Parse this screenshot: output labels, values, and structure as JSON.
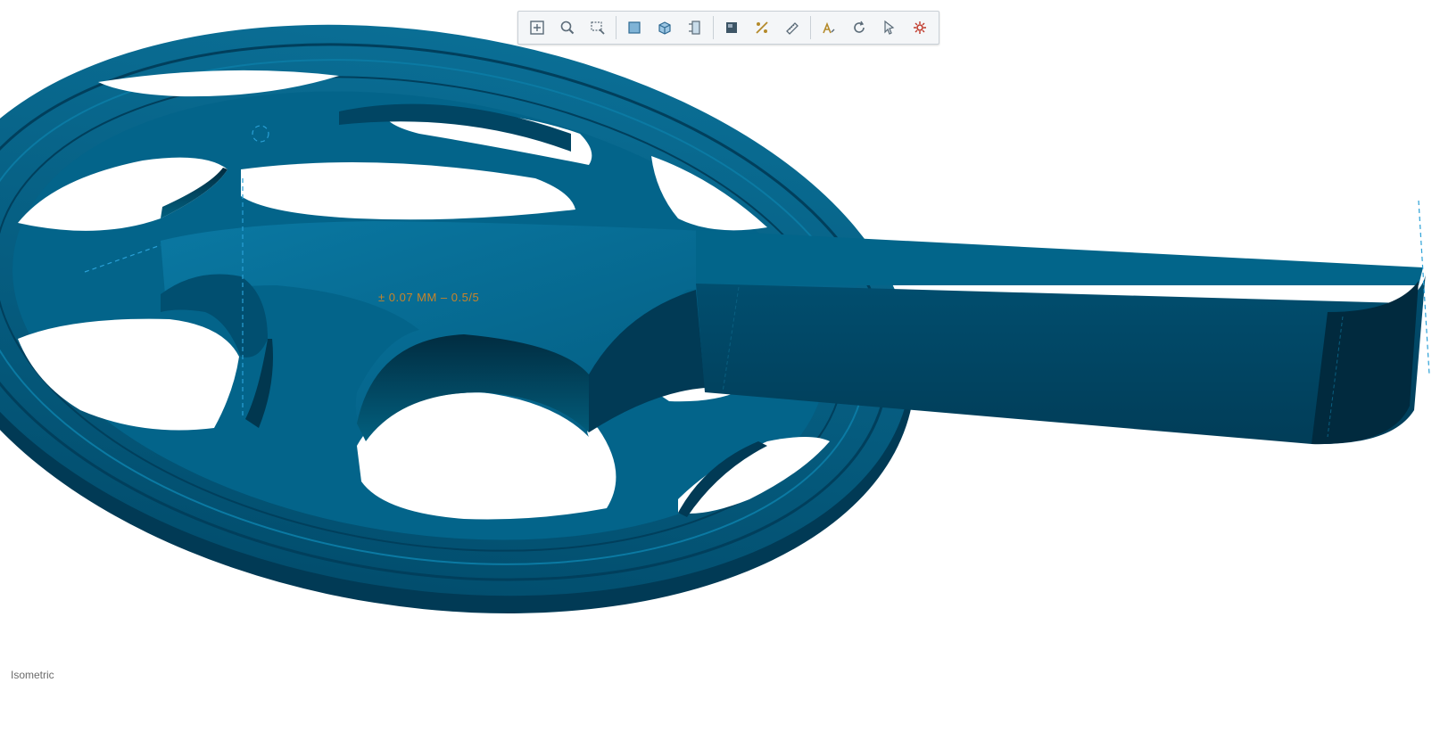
{
  "toolbar": {
    "tools": [
      {
        "id": "fit-all",
        "icon": "fit-all-icon"
      },
      {
        "id": "zoom",
        "icon": "zoom-icon"
      },
      {
        "id": "zoom-window",
        "icon": "zoom-window-icon"
      },
      {
        "id": "view-front",
        "icon": "front-view-icon"
      },
      {
        "id": "view-iso",
        "icon": "isometric-view-icon"
      },
      {
        "id": "view-side",
        "icon": "side-view-icon"
      },
      {
        "id": "display-mode",
        "icon": "shaded-display-icon"
      },
      {
        "id": "section",
        "icon": "section-icon"
      },
      {
        "id": "measure",
        "icon": "measure-icon"
      },
      {
        "id": "annotate",
        "icon": "annotate-icon"
      },
      {
        "id": "rotate",
        "icon": "rotate-icon"
      },
      {
        "id": "select",
        "icon": "select-icon"
      },
      {
        "id": "settings",
        "icon": "settings-icon"
      }
    ]
  },
  "colors": {
    "model": "#02658a",
    "model_dark": "#014563",
    "model_edge": "#013a55",
    "background": "#ffffff",
    "guide": "#2aa0d6",
    "annotation": "#c8842a"
  },
  "viewport": {
    "annotation_text": "± 0.07 MM – 0.5/5",
    "view_label": "Isometric"
  }
}
